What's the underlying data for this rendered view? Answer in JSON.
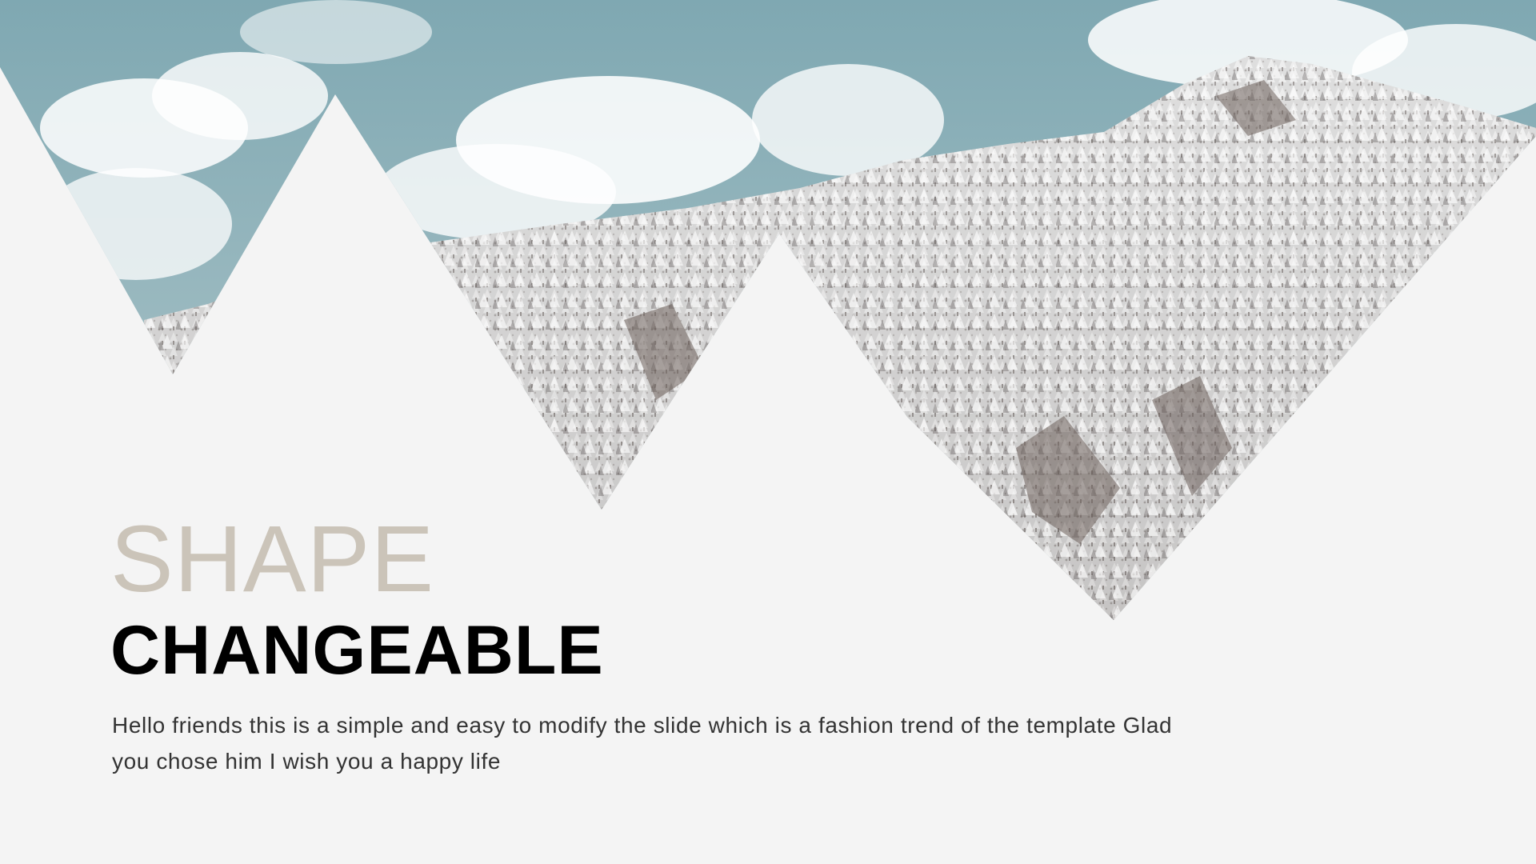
{
  "slide": {
    "title_line1": "SHAPE",
    "title_line2": "CHANGEABLE",
    "body_line1": "Hello friends this is a simple and easy to modify the slide which is a fashion trend of the template Glad",
    "body_line2": "you chose him I wish you a happy life"
  },
  "colors": {
    "background": "#f4f4f4",
    "title_accent": "#cbc4b9",
    "title_main": "#000000",
    "body_text": "#333333",
    "sky": "#8fb0b8"
  }
}
